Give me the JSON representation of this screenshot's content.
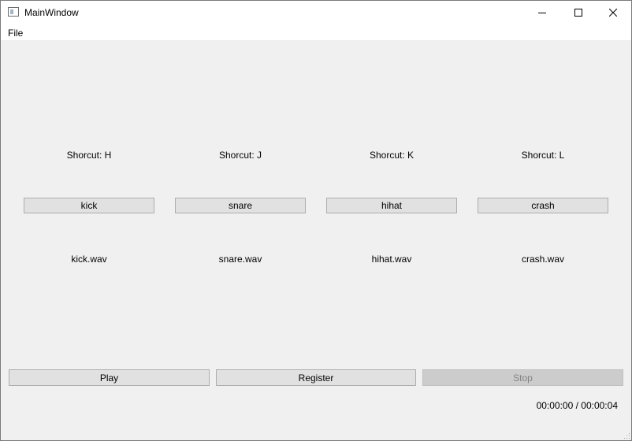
{
  "window": {
    "title": "MainWindow"
  },
  "icons": {
    "app": "window-app-icon",
    "minimize": "minimize-icon",
    "maximize": "maximize-icon",
    "close": "close-icon",
    "grip": "resize-grip-icon"
  },
  "menu": {
    "items": [
      {
        "label": "File"
      }
    ]
  },
  "pads": [
    {
      "shortcut": "Shorcut: H",
      "button": "kick",
      "file": "kick.wav"
    },
    {
      "shortcut": "Shorcut: J",
      "button": "snare",
      "file": "snare.wav"
    },
    {
      "shortcut": "Shorcut: K",
      "button": "hihat",
      "file": "hihat.wav"
    },
    {
      "shortcut": "Shorcut: L",
      "button": "crash",
      "file": "crash.wav"
    }
  ],
  "controls": {
    "play": "Play",
    "register": "Register",
    "stop": "Stop",
    "stop_enabled": false
  },
  "time": "00:00:00 / 00:00:04"
}
